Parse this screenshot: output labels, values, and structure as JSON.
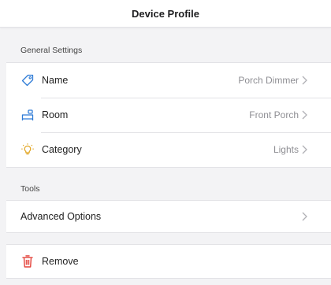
{
  "navbar": {
    "title": "Device Profile"
  },
  "sections": {
    "general": {
      "header": "General Settings",
      "rows": [
        {
          "label": "Name",
          "value": "Porch Dimmer",
          "icon": "tag-icon"
        },
        {
          "label": "Room",
          "value": "Front Porch",
          "icon": "bed-icon"
        },
        {
          "label": "Category",
          "value": "Lights",
          "icon": "light-icon"
        }
      ]
    },
    "tools": {
      "header": "Tools",
      "rows": [
        {
          "label": "Advanced Options",
          "icon": "chevron-right-icon"
        }
      ]
    },
    "danger": {
      "rows": [
        {
          "label": "Remove",
          "icon": "trash-icon"
        }
      ]
    }
  },
  "colors": {
    "accent": "#2e7bd6",
    "destructive": "#e3423a",
    "chevron": "#b0b0b5",
    "value_text": "#8e8e93",
    "background": "#f3f3f5"
  }
}
